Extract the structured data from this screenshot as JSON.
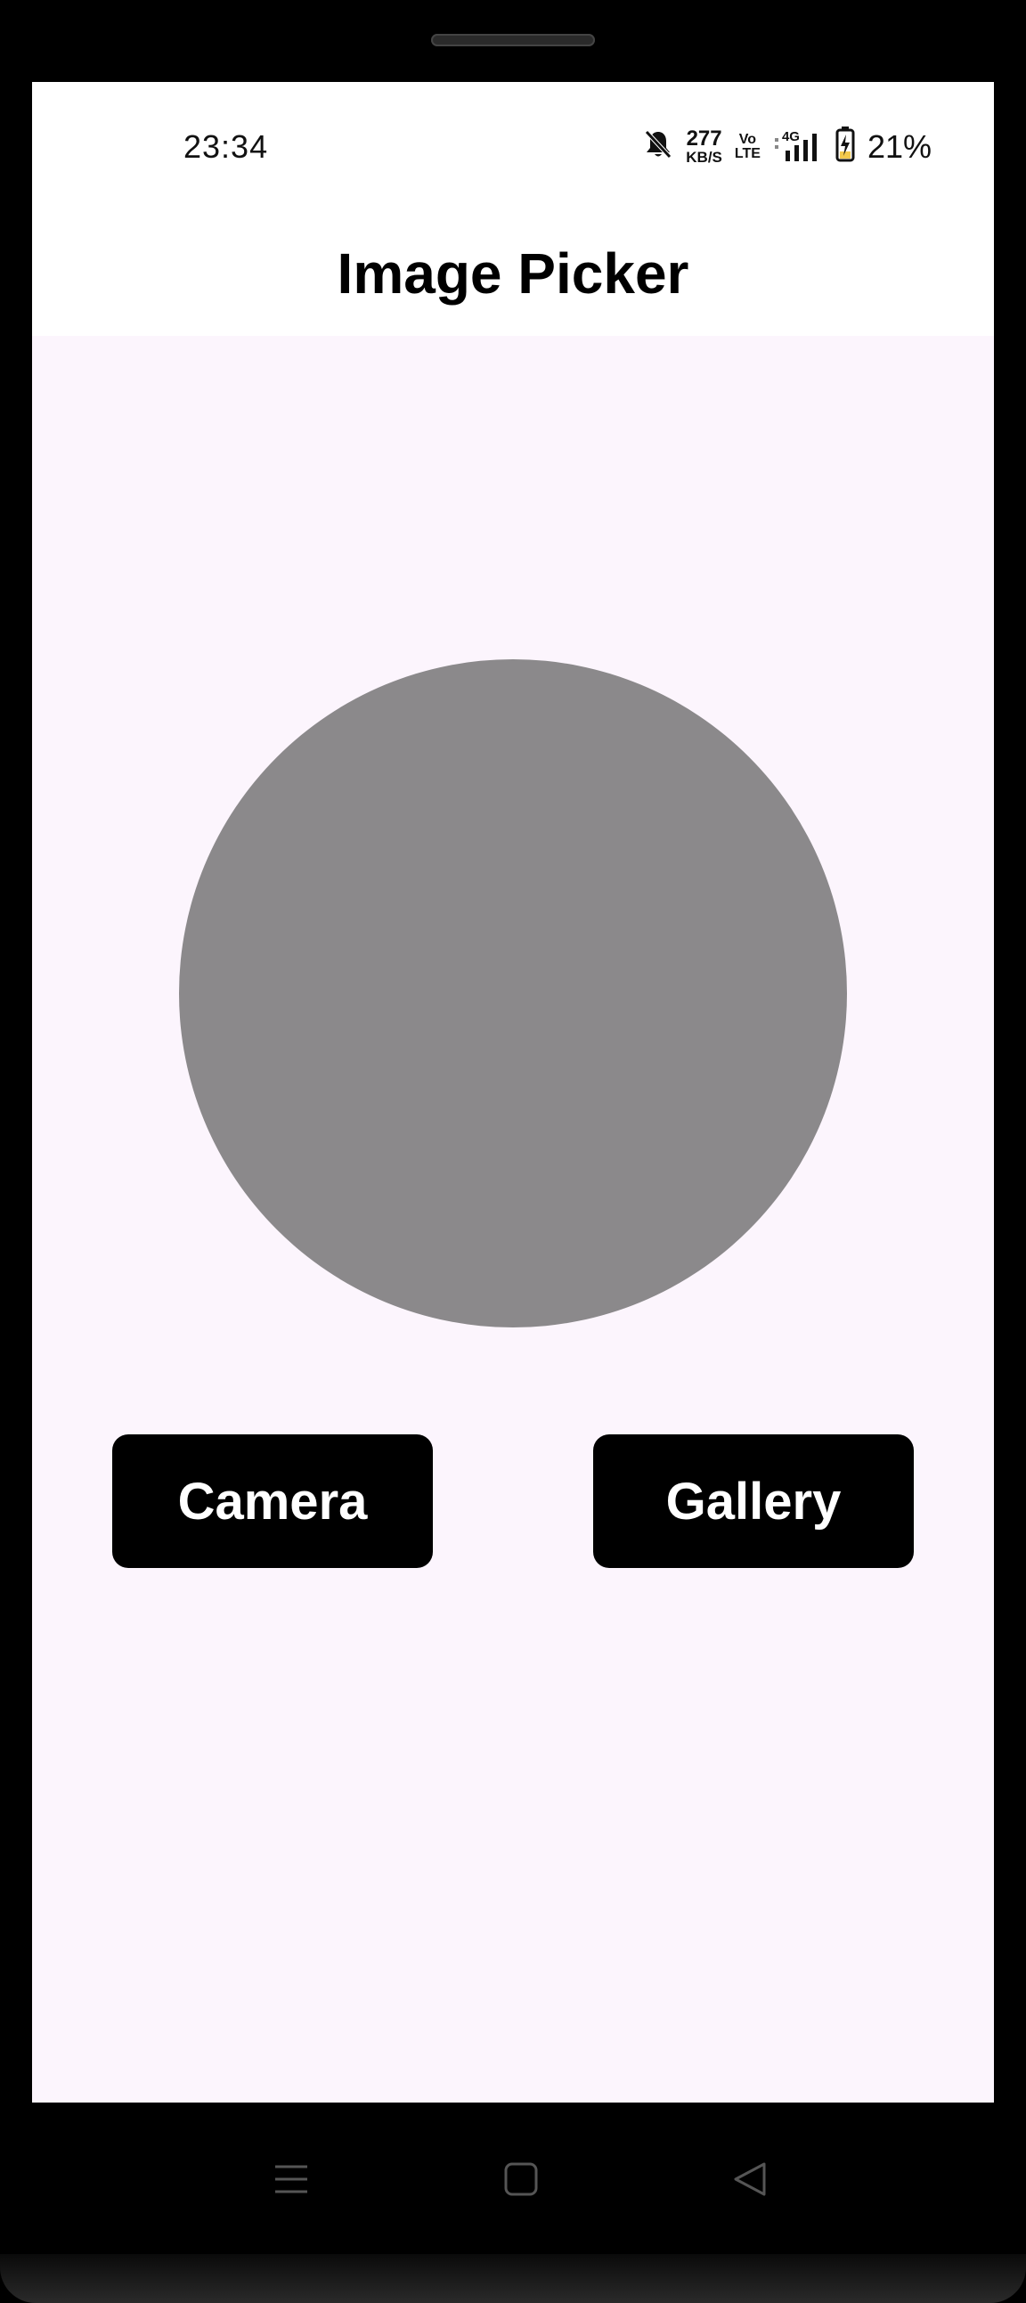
{
  "status_bar": {
    "time": "23:34",
    "net_speed_value": "277",
    "net_speed_unit": "KB/S",
    "volte_top": "Vo",
    "volte_bottom": "LTE",
    "network": "4G",
    "battery_percent": "21%",
    "icons": [
      "mute-bell-icon",
      "signal-icon",
      "battery-charging-icon"
    ]
  },
  "app_bar": {
    "title": "Image Picker"
  },
  "image_placeholder": {
    "color": "#8b898b"
  },
  "actions": {
    "camera_label": "Camera",
    "gallery_label": "Gallery"
  },
  "nav_bar": {
    "icons": [
      "menu-icon",
      "home-icon",
      "back-icon"
    ]
  },
  "colors": {
    "background": "#fcf5fd",
    "button": "#000000",
    "button_text": "#ffffff"
  }
}
